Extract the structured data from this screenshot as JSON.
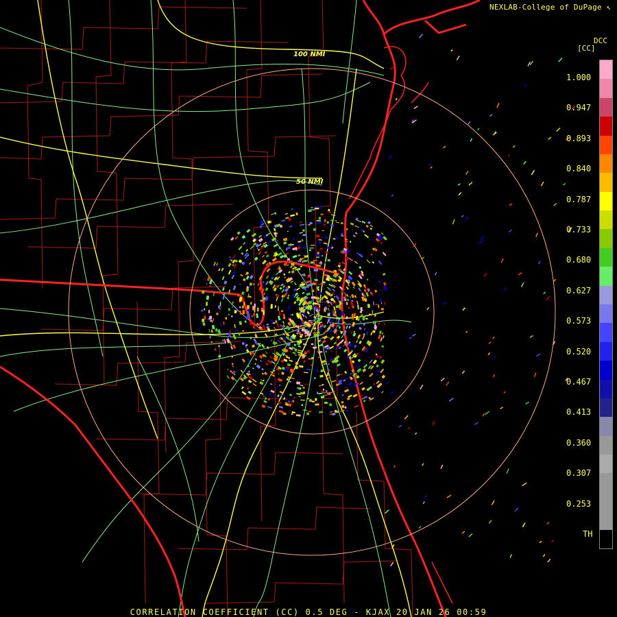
{
  "credit": "NEXLAB-College of DuPage",
  "credit_icon": "cursor-icon",
  "colorbar": {
    "code": "DCC",
    "unit": "[CC]",
    "ticks": [
      "1.000",
      "0.947",
      "0.893",
      "0.840",
      "0.787",
      "0.733",
      "0.680",
      "0.627",
      "0.573",
      "0.520",
      "0.467",
      "0.413",
      "0.360",
      "0.307",
      "0.253",
      "TH"
    ],
    "colors": [
      "#ffaacc",
      "#ee88aa",
      "#cc4466",
      "#cc0000",
      "#ff4400",
      "#ff8800",
      "#ffbb00",
      "#ffff00",
      "#ccdd00",
      "#88cc00",
      "#44cc22",
      "#66ee66",
      "#9999dd",
      "#7777ee",
      "#4444ff",
      "#2222ee",
      "#0000cc",
      "#1111aa",
      "#222288",
      "#8888aa",
      "#999999",
      "#aaaaaa",
      "#999999",
      "#999999",
      "#999999",
      "#000000"
    ]
  },
  "range_rings": [
    {
      "label": "100 NMI"
    },
    {
      "label": "50 NMI"
    }
  ],
  "footer": "CORRELATION COEFFICIENT (CC) 0.5 DEG - KJAX 20 JAN 26 00:59",
  "map_colors": {
    "background": "#000000",
    "coast_state": "#ff2222",
    "county": "#aa1a1a",
    "interstate": "#ffff44",
    "highway": "#88ee88",
    "ring": "#ffaa88"
  }
}
